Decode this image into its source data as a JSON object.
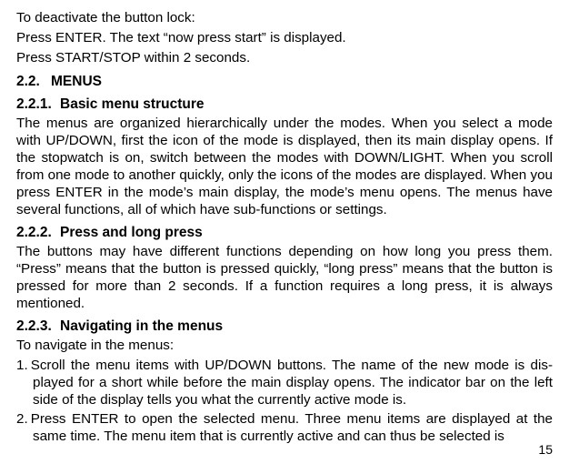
{
  "intro": {
    "line1": "To deactivate the button lock:",
    "line2": "Press ENTER. The text “now press start” is displayed.",
    "line3": "Press START/STOP within 2 seconds."
  },
  "section22": {
    "num": "2.2.",
    "title": "MENUS"
  },
  "section221": {
    "num": "2.2.1.",
    "title": "Basic menu structure",
    "body": "The menus are organized hierarchically under the modes. When you select a mode with UP/DOWN, first the icon of the mode is displayed, then its main display opens. If the stopwatch is on, switch between the modes with DOWN/LIGHT. When you scroll from one mode to another quickly, only the icons of the modes are displayed. When you press ENTER in the mode’s main display, the mode’s menu opens. The menus have several functions, all of which have sub-functions or settings."
  },
  "section222": {
    "num": "2.2.2.",
    "title": "Press and long press",
    "body": "The buttons may have different functions depending on how long you press them. “Press” means that the button is pressed quickly, “long press” means that the button is pressed for more than 2 seconds. If a function requires a long press, it is always mentioned."
  },
  "section223": {
    "num": "2.2.3.",
    "title": "Navigating in the menus",
    "lead": "To navigate in the menus:",
    "item1": "1. Scroll the menu items with UP/DOWN buttons. The name of the new mode is dis­played for a short while before the main display opens. The indicator bar on the left side of the display tells you what the currently active mode is.",
    "item2": "2. Press ENTER to open the selected menu. Three menu items are displayed at the same time. The menu item that is currently active and can thus be selected is"
  },
  "page_number": "15"
}
